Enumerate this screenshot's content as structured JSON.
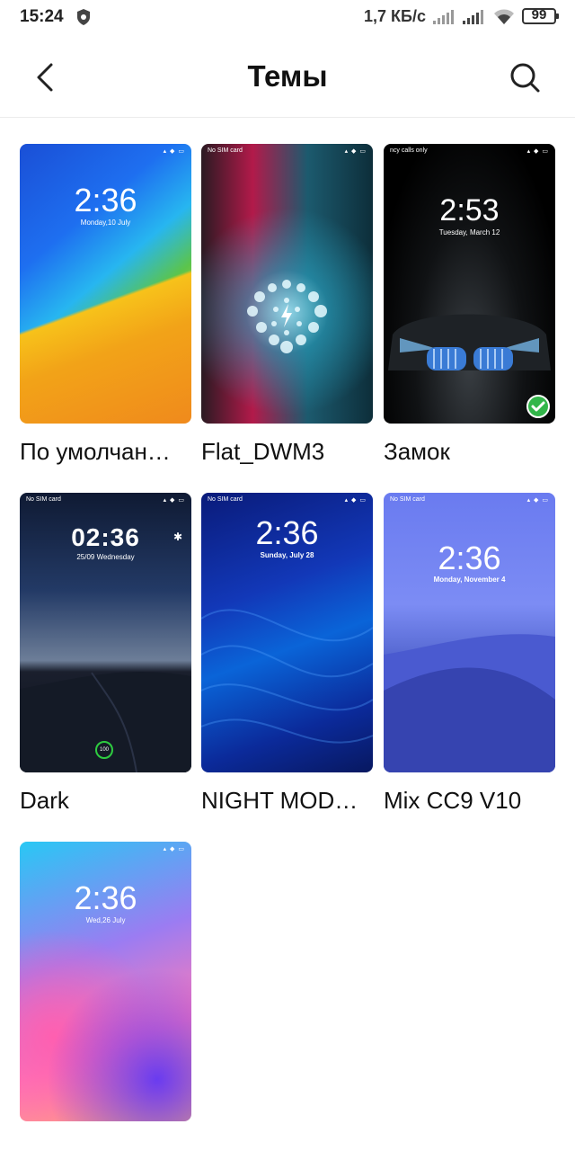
{
  "statusbar": {
    "time": "15:24",
    "speed": "1,7 КБ/с",
    "battery": "99"
  },
  "header": {
    "title": "Темы"
  },
  "themes": [
    {
      "label": "По умолчан…",
      "thumb_time": "2:36",
      "thumb_date": "Monday,10  July",
      "thumb_top": ""
    },
    {
      "label": "Flat_DWM3",
      "thumb_time": "",
      "thumb_date": "",
      "thumb_top": "No SIM card"
    },
    {
      "label": "Замок",
      "thumb_time": "2:53",
      "thumb_date": "Tuesday, March 12",
      "thumb_top": "ncy calls only",
      "selected": true
    },
    {
      "label": "Dark",
      "thumb_time": "02:36",
      "thumb_date": "25/09 Wednesday",
      "thumb_top": "No SIM card",
      "thumb_ring": "100"
    },
    {
      "label": "NIGHT MOD…",
      "thumb_time": "2:36",
      "thumb_date": "Sunday, July 28",
      "thumb_top": "No SIM card"
    },
    {
      "label": "Mix CC9 V10",
      "thumb_time": "2:36",
      "thumb_date": "Monday, November 4",
      "thumb_top": "No SIM card"
    },
    {
      "label": "",
      "thumb_time": "2:36",
      "thumb_date": "Wed,26  July",
      "thumb_top": ""
    }
  ],
  "colors": {
    "selected_check": "#32b64a"
  }
}
